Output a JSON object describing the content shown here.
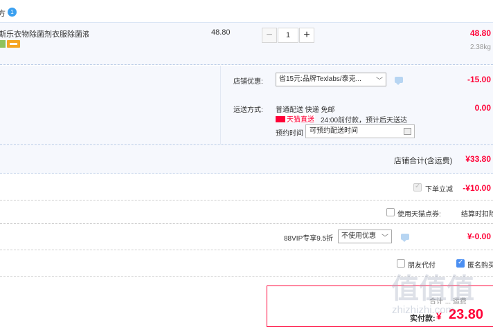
{
  "store": {
    "name_partial": "方",
    "badge": "1"
  },
  "item": {
    "title": "斯乐衣物除菌剂衣服除菌液...",
    "unit_price": "48.80",
    "quantity": "1",
    "minus": "−",
    "plus": "+",
    "subtotal": "48.80",
    "weight": "2.38kg"
  },
  "shop_promo": {
    "label": "店铺优惠:",
    "selected": "省15元:品牌Texlabs/泰克...",
    "amount": "-15.00"
  },
  "shipping": {
    "label": "运送方式:",
    "method": "普通配送 快递 免邮",
    "tmall_label": "天猫直送",
    "delivery_note": "24:00前付款，预计后天送达",
    "amount": "0.00",
    "schedule_label": "预约时间",
    "schedule_placeholder": "可预约配送时间"
  },
  "store_total": {
    "label": "店铺合计(含运费)",
    "amount": "¥33.80"
  },
  "instant_discount": {
    "label": "下单立减",
    "amount": "-¥10.00"
  },
  "tmall_points": {
    "label": "使用天猫点券:",
    "note": "结算时扣除"
  },
  "vip": {
    "label": "88VIP专享9.5折",
    "selected": "不使用优惠",
    "amount": "¥-0.00"
  },
  "options": {
    "friend_pay": "朋友代付",
    "anonymous": "匿名购买"
  },
  "payment": {
    "label": "实付款:",
    "currency": "¥",
    "amount": "23.80",
    "faint": "合计 ... 运费"
  },
  "watermark": {
    "main": "值值值",
    "sub": "zhizhizhi.com"
  },
  "colors": {
    "accent_red": "#ff0036",
    "panel_bg": "#f6f8fd",
    "checkbox_blue": "#4b8ff2"
  }
}
